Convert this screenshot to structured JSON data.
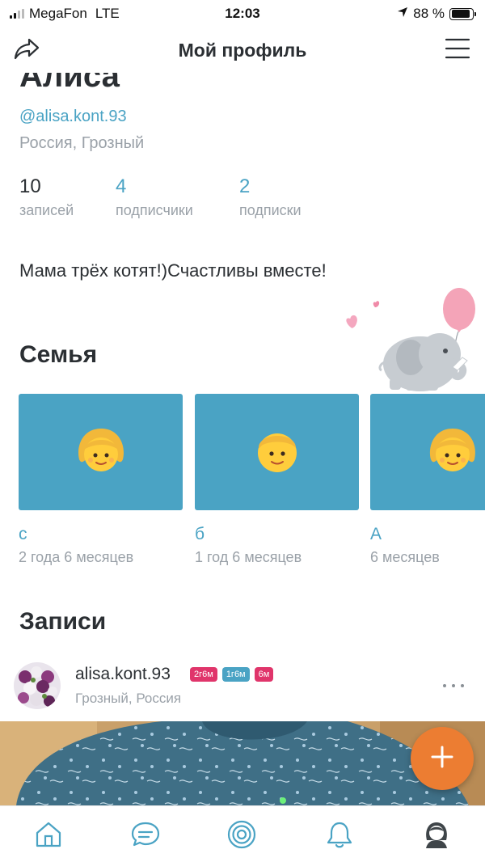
{
  "status_bar": {
    "carrier": "MegaFon",
    "network": "LTE",
    "time": "12:03",
    "battery": "88 %",
    "battery_level": 0.88
  },
  "header": {
    "title": "Мой профиль",
    "share_icon": "share-arrow-icon",
    "menu_icon": "hamburger-menu-icon"
  },
  "profile": {
    "name": "Алиса",
    "handle": "@alisa.kont.93",
    "location": "Россия, Грозный",
    "stats": [
      {
        "value": "10",
        "label": "записей"
      },
      {
        "value": "4",
        "label": "подписчики"
      },
      {
        "value": "2",
        "label": "подписки"
      }
    ],
    "bio": "Мама трёх котят!)Счастливы вместе!"
  },
  "family": {
    "title": "Семья",
    "children": [
      {
        "name": "с",
        "age": "2 года 6 месяцев",
        "emoji": "👧"
      },
      {
        "name": "б",
        "age": "1 год 6 месяцев",
        "emoji": "👦"
      },
      {
        "name": "А",
        "age": "6 месяцев",
        "emoji": "👧"
      }
    ]
  },
  "posts": {
    "title": "Записи",
    "items": [
      {
        "author": "alisa.kont.93",
        "location": "Грозный, Россия",
        "tags": [
          {
            "text": "2г6м",
            "color": "#e0356b"
          },
          {
            "text": "1г6м",
            "color": "#4aa3c4"
          },
          {
            "text": "6м",
            "color": "#e0356b"
          }
        ]
      }
    ]
  },
  "fab": {
    "icon": "plus-icon",
    "color": "#ec7d32"
  },
  "bottom_nav": [
    {
      "name": "home",
      "icon": "home-icon"
    },
    {
      "name": "messages",
      "icon": "chat-bubble-icon"
    },
    {
      "name": "feed",
      "icon": "target-circles-icon"
    },
    {
      "name": "notifications",
      "icon": "bell-icon"
    },
    {
      "name": "profile",
      "icon": "avatar-woman-icon",
      "active": true
    }
  ],
  "colors": {
    "accent": "#4aa3c4",
    "text": "#2b2f33",
    "muted": "#9aa1a8",
    "fab": "#ec7d32"
  }
}
